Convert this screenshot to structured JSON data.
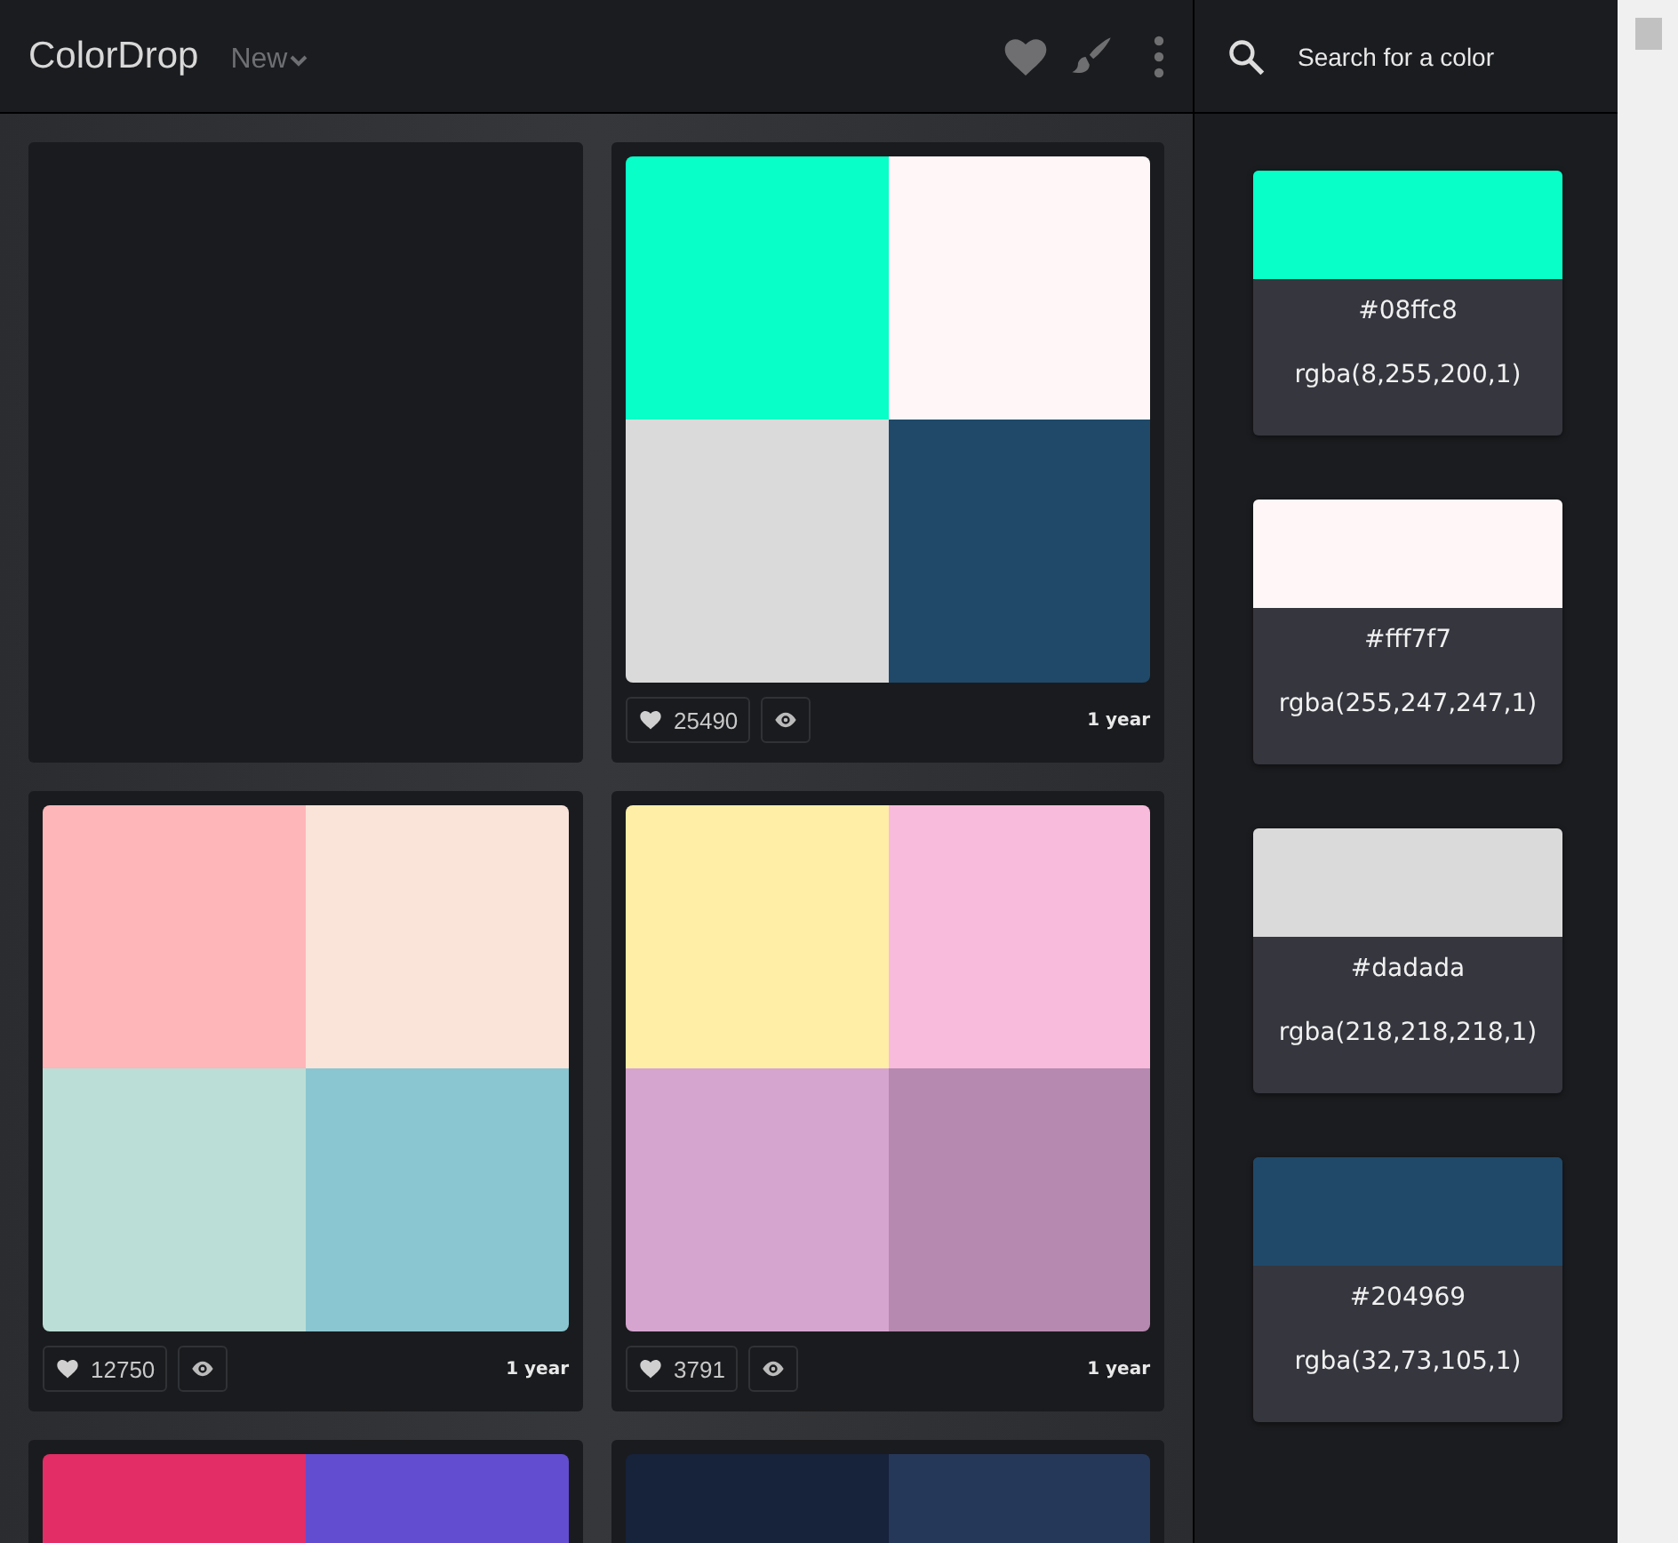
{
  "header": {
    "logo": "ColorDrop",
    "sort": "New",
    "search": {
      "placeholder": "Search for a color"
    }
  },
  "cards": [
    {
      "kind": "empty"
    },
    {
      "kind": "palette",
      "swatches": [
        {
          "color": "#08ffc8"
        },
        {
          "color": "#fff7f7"
        },
        {
          "color": "#dadada"
        },
        {
          "color": "#204969"
        }
      ],
      "likes": "25490",
      "age": "1 year"
    },
    {
      "kind": "palette",
      "swatches": [
        {
          "color": "#ffb6b9"
        },
        {
          "color": "#fae3d9"
        },
        {
          "color": "#bbded6"
        },
        {
          "color": "#8ac6d1"
        }
      ],
      "likes": "12750",
      "age": "1 year"
    },
    {
      "kind": "palette",
      "swatches": [
        {
          "color": "#ffeea6"
        },
        {
          "color": "#f8bbdc"
        },
        {
          "color": "#d5a4cf"
        },
        {
          "color": "#b689b0"
        }
      ],
      "likes": "3791",
      "age": "1 year"
    },
    {
      "kind": "palette",
      "swatches": [
        {
          "color": "#e22d66"
        },
        {
          "color": "#624dd0"
        }
      ]
    },
    {
      "kind": "palette",
      "swatches": [
        {
          "color": "#17223b"
        },
        {
          "color": "#263859"
        }
      ]
    }
  ],
  "details": [
    {
      "color": "#08ffc8",
      "hex": "#08ffc8",
      "rgba": "rgba(8,255,200,1)"
    },
    {
      "color": "#fff7f7",
      "hex": "#fff7f7",
      "rgba": "rgba(255,247,247,1)"
    },
    {
      "color": "#dadada",
      "hex": "#dadada",
      "rgba": "rgba(218,218,218,1)"
    },
    {
      "color": "#204969",
      "hex": "#204969",
      "rgba": "rgba(32,73,105,1)"
    }
  ]
}
